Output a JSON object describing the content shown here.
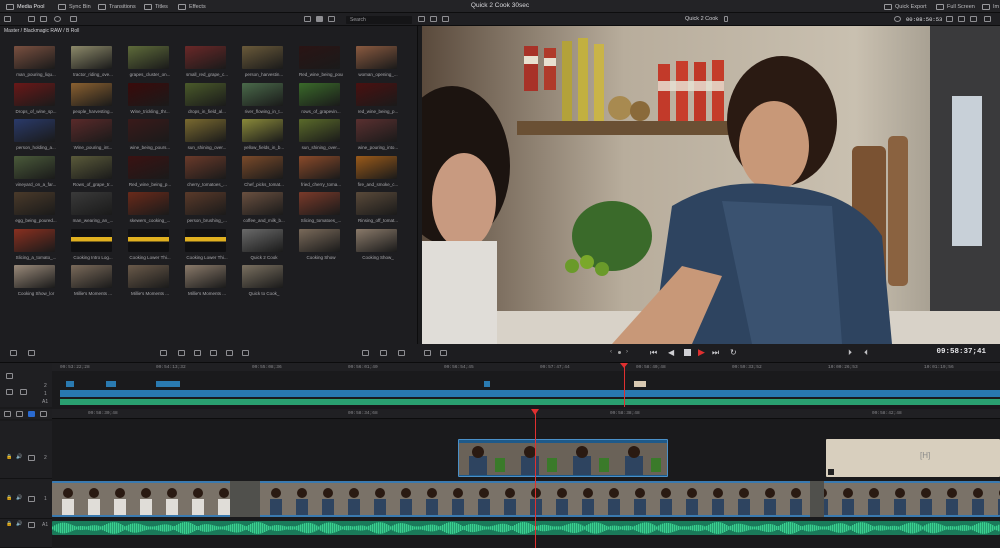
{
  "topbar": {
    "tabs": [
      {
        "label": "Media Pool",
        "active": true
      },
      {
        "label": "Sync Bin",
        "active": false
      },
      {
        "label": "Transitions",
        "active": false
      },
      {
        "label": "Titles",
        "active": false
      },
      {
        "label": "Effects",
        "active": false
      }
    ],
    "title": "Quick 2 Cook 30sec",
    "quick_export": "Quick Export",
    "full_screen": "Full Screen",
    "right_extra": "Im"
  },
  "toolbar2": {
    "search_placeholder": "Search",
    "clip_name": "Quick 2 Cook",
    "timecode": "00:08:50:53"
  },
  "media_pool": {
    "path": "Master / Blackmagic RAW / B Roll",
    "clips": [
      {
        "label": "man_pouring_liqu...",
        "color": "#7a5040"
      },
      {
        "label": "tractor_riding_ove...",
        "color": "#8d8a6a"
      },
      {
        "label": "grapes_cluster_on...",
        "color": "#5e6b3a"
      },
      {
        "label": "small_red_grape_c...",
        "color": "#6a2828"
      },
      {
        "label": "person_harvestin...",
        "color": "#6a5a3a"
      },
      {
        "label": "Red_wine_being_pour...",
        "color": "#2a1414"
      },
      {
        "label": "woman_opening_...",
        "color": "#8a5a40"
      },
      {
        "label": "Drops_of_wine_sp...",
        "color": "#6a1818"
      },
      {
        "label": "people_harvesting...",
        "color": "#8a6030"
      },
      {
        "label": "Wine_trickling_thr...",
        "color": "#3a0a0a"
      },
      {
        "label": "drops_in_field_al...",
        "color": "#4a5a2a"
      },
      {
        "label": "river_flowing_in_t...",
        "color": "#4a6a4a"
      },
      {
        "label": "rows_of_grapevin...",
        "color": "#3a6a2a"
      },
      {
        "label": "red_wine_being_p...",
        "color": "#4a1010"
      },
      {
        "label": "person_holding_a...",
        "color": "#2a3a6a"
      },
      {
        "label": "Wine_pouring_int...",
        "color": "#5a2a2a"
      },
      {
        "label": "wine_being_pours...",
        "color": "#3a1a1a"
      },
      {
        "label": "sun_shining_over...",
        "color": "#7a6a30"
      },
      {
        "label": "yellow_fields_in_b...",
        "color": "#8a8a3a"
      },
      {
        "label": "sun_shining_over...",
        "color": "#5a6a2a"
      },
      {
        "label": "wine_pouring_into...",
        "color": "#5a3030"
      },
      {
        "label": "vineyard_on_a_far...",
        "color": "#4a5a3a"
      },
      {
        "label": "Rows_of_grape_tr...",
        "color": "#5a5a3a"
      },
      {
        "label": "Red_wine_being_p...",
        "color": "#3a1212"
      },
      {
        "label": "cherry_tomatoes_...",
        "color": "#6a3a2a"
      },
      {
        "label": "Chef_picks_tomat...",
        "color": "#7a4a2a"
      },
      {
        "label": "fried_cherry_toma...",
        "color": "#8a4a2a"
      },
      {
        "label": "fire_and_smoke_c...",
        "color": "#9a5a1a"
      },
      {
        "label": "egg_being_poured...",
        "color": "#4a3a2a"
      },
      {
        "label": "man_wearing_an_...",
        "color": "#3a3a3a"
      },
      {
        "label": "skewers_cooking_...",
        "color": "#6a2a1a"
      },
      {
        "label": "person_brushing_...",
        "color": "#5a3a2a"
      },
      {
        "label": "coffee_and_milk_b...",
        "color": "#6a5040"
      },
      {
        "label": "Slicing_tomatoes_...",
        "color": "#7a3a2a"
      },
      {
        "label": "Rinsing_off_tomat...",
        "color": "#5a4a3a"
      },
      {
        "label": "Slicing_a_tomato_...",
        "color": "#8a3020"
      },
      {
        "label": "Cooking Intro Log...",
        "color": "#101012",
        "accent": "#e0b020"
      },
      {
        "label": "Cooking Lower Thi...",
        "color": "#101012",
        "accent": "#e0b020"
      },
      {
        "label": "Cooking Lower Thi...",
        "color": "#101012",
        "accent": "#e0b020"
      },
      {
        "label": "Quick 2 Cook",
        "color": "#6a6a6a"
      },
      {
        "label": "Cooking Show",
        "color": "#7a6a5a"
      },
      {
        "label": "Cooking Show_",
        "color": "#8a7a6a"
      },
      {
        "label": "Cooking Show_lor",
        "color": "#9a8a7a"
      },
      {
        "label": "Millie's Moments ...",
        "color": "#7a6a5a"
      },
      {
        "label": "Millie's Moments ...",
        "color": "#6a5a4a"
      },
      {
        "label": "Millie's Moments ...",
        "color": "#8a7a6a"
      },
      {
        "label": "Quick to Cook_",
        "color": "#7a7060"
      }
    ]
  },
  "viewer": {
    "timecode": "09:58:37;41"
  },
  "timeline": {
    "ruler_top": [
      "09:53:22;28",
      "09:54:13;32",
      "09:55:08;36",
      "09:56:01;40",
      "09:56:54;45",
      "09:57:47;44",
      "09:58:40;48",
      "09:59:33;52",
      "10:00:26;53",
      "10:01:19;56"
    ],
    "ruler_main": [
      "09:58:30;48",
      "09:58:34;68",
      "09:58:38;48",
      "09:58:42;48"
    ],
    "tracks": [
      {
        "id": "V2",
        "label": "2"
      },
      {
        "id": "V1",
        "label": "1"
      },
      {
        "id": "A1",
        "label": "A1"
      }
    ]
  }
}
